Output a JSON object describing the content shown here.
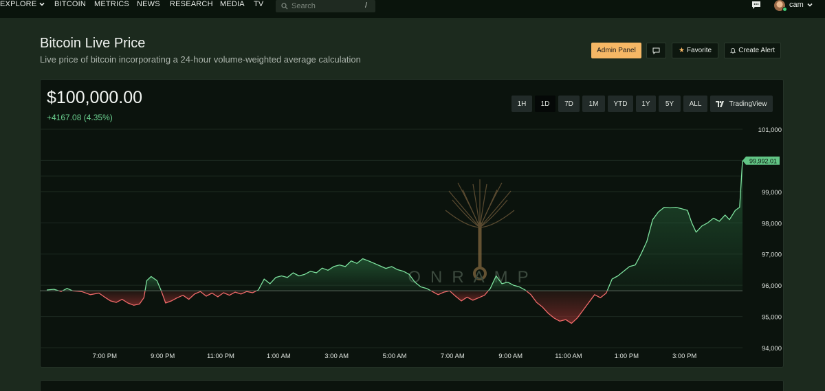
{
  "nav": {
    "items": [
      "EXPLORE",
      "BITCOIN",
      "METRICS",
      "NEWS",
      "RESEARCH",
      "MEDIA",
      "TV"
    ],
    "search_placeholder": "Search",
    "search_shortcut": "/",
    "user_name": "cam",
    "icons": [
      "chevron-down-icon",
      "chat-icon",
      "avatar"
    ]
  },
  "header": {
    "title": "Bitcoin Live Price",
    "subtitle": "Live price of bitcoin incorporating a 24-hour volume-weighted average calculation",
    "buttons": {
      "admin": "Admin Panel",
      "favorite": "Favorite",
      "alert": "Create Alert"
    }
  },
  "chart_card": {
    "price": "$100,000.00",
    "change": "+4167.08 (4.35%)",
    "ranges": [
      "1H",
      "1D",
      "7D",
      "1M",
      "YTD",
      "1Y",
      "5Y",
      "ALL"
    ],
    "active_range": "1D",
    "tradingview_label": "TradingView",
    "watermark": "ONRAMP"
  },
  "colors": {
    "up": "#7ee39f",
    "down": "#f16a6a",
    "accent": "#f6b765"
  },
  "chart_data": {
    "type": "area",
    "title": "",
    "xlabel": "",
    "ylabel": "",
    "baseline": 95825,
    "last_value_label": "99,992.01",
    "ylim": [
      94000,
      101000
    ],
    "y_ticks": [
      94000,
      95000,
      96000,
      97000,
      98000,
      99000,
      101000
    ],
    "y_tick_labels": [
      "94,000",
      "95,000",
      "96,000",
      "97,000",
      "98,000",
      "99,000",
      "101,000"
    ],
    "x_tick_labels": [
      "7:00 PM",
      "9:00 PM",
      "11:00 PM",
      "1:00 AM",
      "3:00 AM",
      "5:00 AM",
      "7:00 AM",
      "9:00 AM",
      "11:00 AM",
      "1:00 PM",
      "3:00 PM"
    ],
    "x_tick_hours": [
      2,
      4,
      6,
      8,
      10,
      12,
      14,
      16,
      18,
      20,
      22
    ],
    "x_range_hours": [
      0,
      24
    ],
    "series": [
      {
        "points": [
          [
            0.0,
            95850
          ],
          [
            0.25,
            95870
          ],
          [
            0.5,
            95800
          ],
          [
            0.7,
            95900
          ],
          [
            0.9,
            95820
          ],
          [
            1.2,
            95800
          ],
          [
            1.5,
            95700
          ],
          [
            1.8,
            95750
          ],
          [
            2.0,
            95620
          ],
          [
            2.2,
            95500
          ],
          [
            2.4,
            95450
          ],
          [
            2.6,
            95550
          ],
          [
            2.8,
            95430
          ],
          [
            3.0,
            95360
          ],
          [
            3.2,
            95400
          ],
          [
            3.35,
            95600
          ],
          [
            3.45,
            96150
          ],
          [
            3.6,
            96280
          ],
          [
            3.8,
            96150
          ],
          [
            3.95,
            95820
          ],
          [
            4.1,
            95430
          ],
          [
            4.3,
            95500
          ],
          [
            4.5,
            95600
          ],
          [
            4.7,
            95680
          ],
          [
            4.9,
            95550
          ],
          [
            5.1,
            95720
          ],
          [
            5.3,
            95800
          ],
          [
            5.5,
            95650
          ],
          [
            5.7,
            95750
          ],
          [
            5.9,
            95630
          ],
          [
            6.1,
            95760
          ],
          [
            6.3,
            95680
          ],
          [
            6.5,
            95780
          ],
          [
            6.7,
            95720
          ],
          [
            6.9,
            95800
          ],
          [
            7.1,
            95760
          ],
          [
            7.3,
            95850
          ],
          [
            7.5,
            96200
          ],
          [
            7.7,
            96050
          ],
          [
            7.9,
            96250
          ],
          [
            8.1,
            96300
          ],
          [
            8.3,
            96250
          ],
          [
            8.5,
            96400
          ],
          [
            8.7,
            96300
          ],
          [
            8.9,
            96350
          ],
          [
            9.1,
            96450
          ],
          [
            9.3,
            96400
          ],
          [
            9.5,
            96550
          ],
          [
            9.7,
            96480
          ],
          [
            9.9,
            96600
          ],
          [
            10.1,
            96650
          ],
          [
            10.3,
            96600
          ],
          [
            10.5,
            96780
          ],
          [
            10.7,
            96700
          ],
          [
            10.9,
            96850
          ],
          [
            11.1,
            96780
          ],
          [
            11.3,
            96700
          ],
          [
            11.5,
            96620
          ],
          [
            11.7,
            96540
          ],
          [
            11.9,
            96600
          ],
          [
            12.1,
            96500
          ],
          [
            12.3,
            96450
          ],
          [
            12.5,
            96350
          ],
          [
            12.7,
            96100
          ],
          [
            12.9,
            95950
          ],
          [
            13.1,
            95900
          ],
          [
            13.3,
            95800
          ],
          [
            13.5,
            95700
          ],
          [
            13.7,
            95780
          ],
          [
            13.9,
            95820
          ],
          [
            14.1,
            95650
          ],
          [
            14.3,
            95500
          ],
          [
            14.5,
            95620
          ],
          [
            14.7,
            95520
          ],
          [
            14.9,
            95600
          ],
          [
            15.1,
            95680
          ],
          [
            15.3,
            95900
          ],
          [
            15.5,
            96300
          ],
          [
            15.7,
            96050
          ],
          [
            15.9,
            96100
          ],
          [
            16.1,
            96000
          ],
          [
            16.3,
            95950
          ],
          [
            16.5,
            95850
          ],
          [
            16.7,
            95700
          ],
          [
            16.9,
            95450
          ],
          [
            17.1,
            95300
          ],
          [
            17.3,
            95100
          ],
          [
            17.5,
            94950
          ],
          [
            17.7,
            94850
          ],
          [
            17.9,
            94900
          ],
          [
            18.1,
            94780
          ],
          [
            18.3,
            94950
          ],
          [
            18.5,
            95200
          ],
          [
            18.7,
            95450
          ],
          [
            18.9,
            95700
          ],
          [
            19.1,
            95600
          ],
          [
            19.3,
            95750
          ],
          [
            19.5,
            96200
          ],
          [
            19.7,
            96300
          ],
          [
            19.9,
            96450
          ],
          [
            20.1,
            96600
          ],
          [
            20.3,
            96650
          ],
          [
            20.5,
            97000
          ],
          [
            20.7,
            97400
          ],
          [
            20.9,
            98100
          ],
          [
            21.1,
            98350
          ],
          [
            21.3,
            98500
          ],
          [
            21.5,
            98480
          ],
          [
            21.7,
            98500
          ],
          [
            21.9,
            98450
          ],
          [
            22.1,
            98400
          ],
          [
            22.25,
            98000
          ],
          [
            22.4,
            97700
          ],
          [
            22.6,
            97900
          ],
          [
            22.8,
            98000
          ],
          [
            23.0,
            98150
          ],
          [
            23.2,
            98050
          ],
          [
            23.4,
            98250
          ],
          [
            23.55,
            98100
          ],
          [
            23.75,
            98400
          ],
          [
            23.9,
            98500
          ],
          [
            24.0,
            99992
          ]
        ]
      }
    ]
  }
}
